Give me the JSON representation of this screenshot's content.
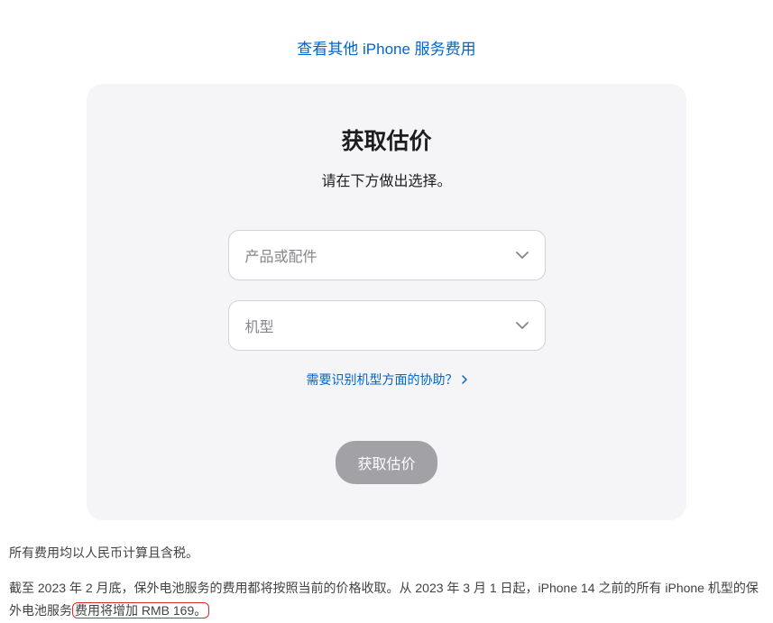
{
  "topLink": {
    "text": "查看其他 iPhone 服务费用"
  },
  "card": {
    "title": "获取估价",
    "subtitle": "请在下方做出选择。",
    "select1": {
      "placeholder": "产品或配件"
    },
    "select2": {
      "placeholder": "机型"
    },
    "helpLink": "需要识别机型方面的协助？",
    "submitLabel": "获取估价"
  },
  "footer": {
    "line1": "所有费用均以人民币计算且含税。",
    "line2_part1": "截至 2023 年 2 月底，保外电池服务的费用都将按照当前的价格收取。从 2023 年 3 月 1 日起，iPhone 14 之前的所有 iPhone 机型的保外电池服务",
    "line2_highlight": "费用将增加 RMB 169。"
  }
}
